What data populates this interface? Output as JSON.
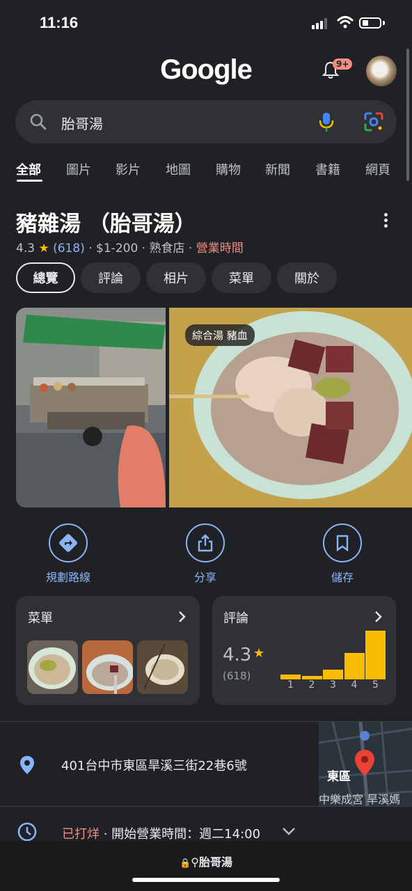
{
  "status": {
    "time": "11:16"
  },
  "header": {
    "logo": "Google",
    "notification_badge": "9+"
  },
  "search": {
    "query": "胎哥湯"
  },
  "tabs": [
    {
      "label": "全部",
      "active": true
    },
    {
      "label": "圖片"
    },
    {
      "label": "影片"
    },
    {
      "label": "地圖"
    },
    {
      "label": "購物"
    },
    {
      "label": "新聞"
    },
    {
      "label": "書籍"
    },
    {
      "label": "網頁"
    }
  ],
  "place": {
    "title": "豬雜湯 （胎哥湯）",
    "rating": "4.3",
    "star": "★",
    "reviews": "(618)",
    "price": "$1-200",
    "category": "熟食店",
    "hours_link": "營業時間",
    "sep": " · "
  },
  "chips": [
    {
      "label": "總覽",
      "active": true
    },
    {
      "label": "評論"
    },
    {
      "label": "相片"
    },
    {
      "label": "菜單"
    },
    {
      "label": "關於"
    }
  ],
  "photo_label": "綜合湯 豬血",
  "actions": [
    {
      "label": "規劃路線",
      "icon": "directions-icon"
    },
    {
      "label": "分享",
      "icon": "share-icon"
    },
    {
      "label": "儲存",
      "icon": "bookmark-icon"
    }
  ],
  "menu_card": {
    "title": "菜單"
  },
  "review_card": {
    "title": "評論",
    "rating": "4.3",
    "star": "★",
    "count": "(618)",
    "bars": [
      {
        "label": "1",
        "share": 0.1
      },
      {
        "label": "2",
        "share": 0.07
      },
      {
        "label": "3",
        "share": 0.2
      },
      {
        "label": "4",
        "share": 0.54
      },
      {
        "label": "5",
        "share": 1.0
      }
    ]
  },
  "address": {
    "text": "401台中市東區旱溪三街22巷6號"
  },
  "map": {
    "district": "東區",
    "place1": "中樂成宮",
    "place2": "旱溪媽"
  },
  "hours": {
    "status": "已打烊",
    "detail": " · 開始營業時間：週二14:00"
  },
  "browser": {
    "url": "胎哥湯"
  },
  "colors": {
    "accent": "#8ab4f8",
    "star": "#fbbc04",
    "closed": "#f28b82",
    "background": "#202124"
  }
}
